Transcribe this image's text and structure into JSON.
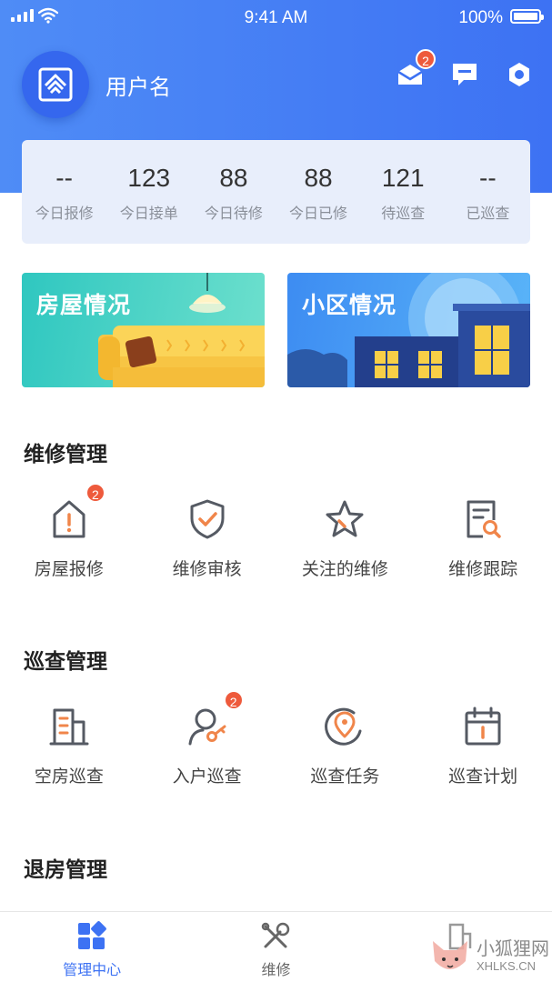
{
  "status_bar": {
    "time": "9:41 AM",
    "battery": "100%"
  },
  "header": {
    "username": "用户名",
    "notification_badge": "2"
  },
  "stats": [
    {
      "value": "--",
      "label": "今日报修"
    },
    {
      "value": "123",
      "label": "今日接单"
    },
    {
      "value": "88",
      "label": "今日待修"
    },
    {
      "value": "88",
      "label": "今日已修"
    },
    {
      "value": "121",
      "label": "待巡查"
    },
    {
      "value": "--",
      "label": "已巡查"
    }
  ],
  "banners": {
    "house": "房屋情况",
    "community": "小区情况"
  },
  "repair_section": {
    "title": "维修管理",
    "items": [
      {
        "label": "房屋报修",
        "badge": "2",
        "icon": "house-alert-icon"
      },
      {
        "label": "维修审核",
        "icon": "shield-check-icon"
      },
      {
        "label": "关注的维修",
        "icon": "star-icon"
      },
      {
        "label": "维修跟踪",
        "icon": "document-search-icon"
      }
    ]
  },
  "inspection_section": {
    "title": "巡查管理",
    "items": [
      {
        "label": "空房巡查",
        "icon": "building-icon"
      },
      {
        "label": "入户巡查",
        "badge": "2",
        "icon": "user-key-icon"
      },
      {
        "label": "巡查任务",
        "icon": "location-pin-icon"
      },
      {
        "label": "巡查计划",
        "icon": "calendar-icon"
      }
    ]
  },
  "checkout_section": {
    "title": "退房管理"
  },
  "tabbar": [
    {
      "label": "管理中心",
      "active": true,
      "icon": "grid-icon"
    },
    {
      "label": "维修",
      "active": false,
      "icon": "tools-icon"
    },
    {
      "label": "",
      "active": false,
      "icon": "building-icon"
    }
  ],
  "watermark": {
    "text": "小狐狸网",
    "url": "XHLKS.CN"
  },
  "colors": {
    "primary": "#3d72f3",
    "accent": "#f0854a",
    "badge": "#ee5a3c",
    "icon": "#555a63"
  }
}
